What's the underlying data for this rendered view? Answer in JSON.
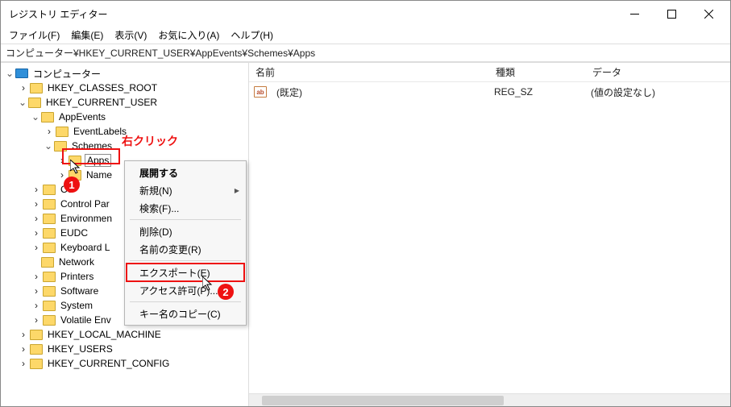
{
  "window": {
    "title": "レジストリ エディター"
  },
  "menubar": {
    "file": "ファイル(F)",
    "edit": "編集(E)",
    "view": "表示(V)",
    "favorites": "お気に入り(A)",
    "help": "ヘルプ(H)"
  },
  "address": "コンピューター¥HKEY_CURRENT_USER¥AppEvents¥Schemes¥Apps",
  "tree": {
    "root": "コンピューター",
    "hkcr": "HKEY_CLASSES_ROOT",
    "hkcu": "HKEY_CURRENT_USER",
    "appevents": "AppEvents",
    "eventlabels": "EventLabels",
    "schemes": "Schemes",
    "apps": "Apps",
    "names": "Name",
    "console": "Co",
    "controlpanel": "Control Par",
    "environment": "Environmen",
    "eudc": "EUDC",
    "keyboard": "Keyboard L",
    "network": "Network",
    "printers": "Printers",
    "software": "Software",
    "system": "System",
    "volatile": "Volatile Env",
    "hklm": "HKEY_LOCAL_MACHINE",
    "hku": "HKEY_USERS",
    "hkcc": "HKEY_CURRENT_CONFIG"
  },
  "list": {
    "headers": {
      "name": "名前",
      "type": "種類",
      "data": "データ"
    },
    "rows": [
      {
        "name": "(既定)",
        "type": "REG_SZ",
        "data": "(値の設定なし)"
      }
    ]
  },
  "contextmenu": {
    "expand": "展開する",
    "new": "新規(N)",
    "find": "検索(F)...",
    "delete": "削除(D)",
    "rename": "名前の変更(R)",
    "export": "エクスポート(E)",
    "permissions": "アクセス許可(P)...",
    "copykeyname": "キー名のコピー(C)"
  },
  "annotations": {
    "rightclick": "右クリック",
    "step1": "1",
    "step2": "2"
  }
}
